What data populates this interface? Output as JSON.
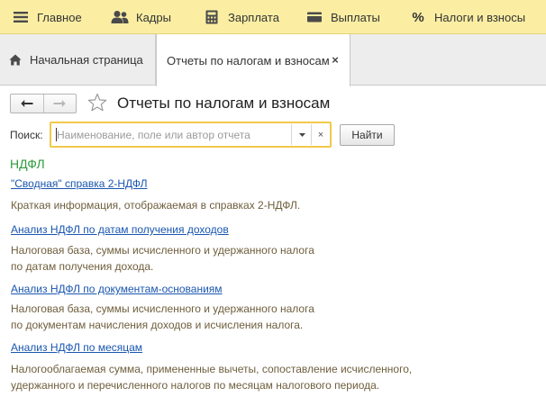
{
  "sections": [
    {
      "label": "Главное",
      "icon": "menu-icon"
    },
    {
      "label": "Кадры",
      "icon": "people-icon"
    },
    {
      "label": "Зарплата",
      "icon": "calculator-icon"
    },
    {
      "label": "Выплаты",
      "icon": "wallet-icon"
    },
    {
      "label": "Налоги и взносы",
      "icon": "percent-icon",
      "icon_text": "%"
    }
  ],
  "tabs": {
    "home": {
      "label": "Начальная страница",
      "icon": "home-icon"
    },
    "active": {
      "label": "Отчеты по налогам и взносам",
      "close_glyph": "×"
    }
  },
  "form": {
    "title": "Отчеты по налогам и взносам",
    "search": {
      "label": "Поиск:",
      "value": "",
      "placeholder": "Наименование, поле или автор отчета",
      "clear_glyph": "×",
      "button_label": "Найти"
    }
  },
  "report_group": {
    "title": "НДФЛ",
    "reports": [
      {
        "link": "\"Сводная\" справка 2-НДФЛ",
        "description": [
          "Краткая информация, отображаемая в справках 2-НДФЛ."
        ]
      },
      {
        "link": "Анализ НДФЛ по датам получения доходов",
        "description": [
          "Налоговая база, суммы исчисленного и удержанного налога",
          "по датам получения дохода."
        ]
      },
      {
        "link": "Анализ НДФЛ по документам-основаниям",
        "description": [
          "Налоговая база, суммы исчисленного и удержанного налога",
          "по документам начисления доходов и исчисления налога."
        ]
      },
      {
        "link": "Анализ НДФЛ по месяцам",
        "description": [
          "Налогооблагаемая сумма, примененные вычеты, сопоставление исчисленного,",
          "удержанного и перечисленного налогов по месяцам налогового периода."
        ]
      }
    ]
  },
  "colors": {
    "section_bar": "#fbeea3",
    "group_title": "#2e9c3e",
    "link": "#1a56b0",
    "description": "#6e5e3c",
    "search_focus": "#f0c94a"
  }
}
